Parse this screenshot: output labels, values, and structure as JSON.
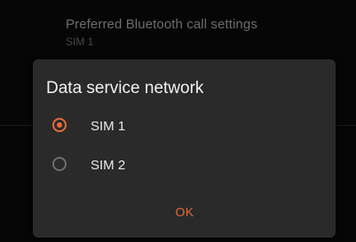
{
  "background_setting": {
    "title": "Preferred Bluetooth call settings",
    "subtitle": "SIM 1"
  },
  "dialog": {
    "title": "Data service network",
    "options": [
      {
        "label": "SIM 1",
        "selected": true
      },
      {
        "label": "SIM 2",
        "selected": false
      }
    ],
    "ok_label": "OK"
  },
  "colors": {
    "accent": "#e56b3d",
    "dialog_background": "#2a2a2a",
    "page_background": "#060606"
  },
  "icons": {
    "selected_radio": "radio-checked-icon",
    "unselected_radio": "radio-unchecked-icon"
  }
}
